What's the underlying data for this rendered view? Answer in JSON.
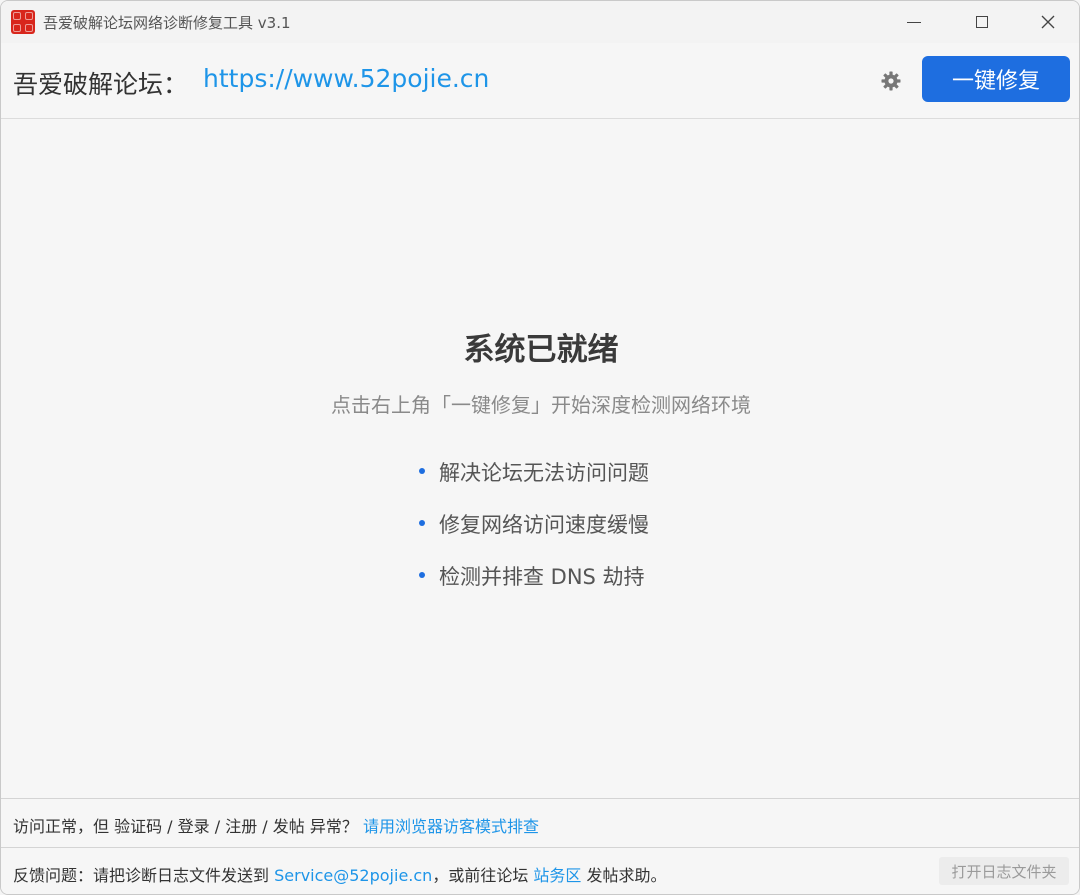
{
  "window": {
    "title": "吾爱破解论坛网络诊断修复工具 v3.1"
  },
  "header": {
    "forum_label": "吾爱破解论坛：",
    "forum_url": "https://www.52pojie.cn",
    "settings_icon": "gear-icon",
    "repair_button_label": "一键修复"
  },
  "main": {
    "status_title": "系统已就绪",
    "status_subtitle": "点击右上角「一键修复」开始深度检测网络环境",
    "features": [
      "解决论坛无法访问问题",
      "修复网络访问速度缓慢",
      "检测并排查 DNS 劫持"
    ]
  },
  "footer": {
    "tip_prefix": "访问正常，但 验证码 / 登录 / 注册 / 发帖 异常？",
    "tip_link": "请用浏览器访客模式排查",
    "feedback_prefix": "反馈问题：请把诊断日志文件发送到",
    "feedback_email": "Service@52pojie.cn",
    "feedback_middle": "，或前往论坛",
    "feedback_link": "站务区",
    "feedback_suffix": "发帖求助。",
    "open_log_label": "打开日志文件夹"
  },
  "colors": {
    "accent": "#1e6ee0",
    "link": "#1e95e8",
    "brand_red": "#d8261c"
  }
}
